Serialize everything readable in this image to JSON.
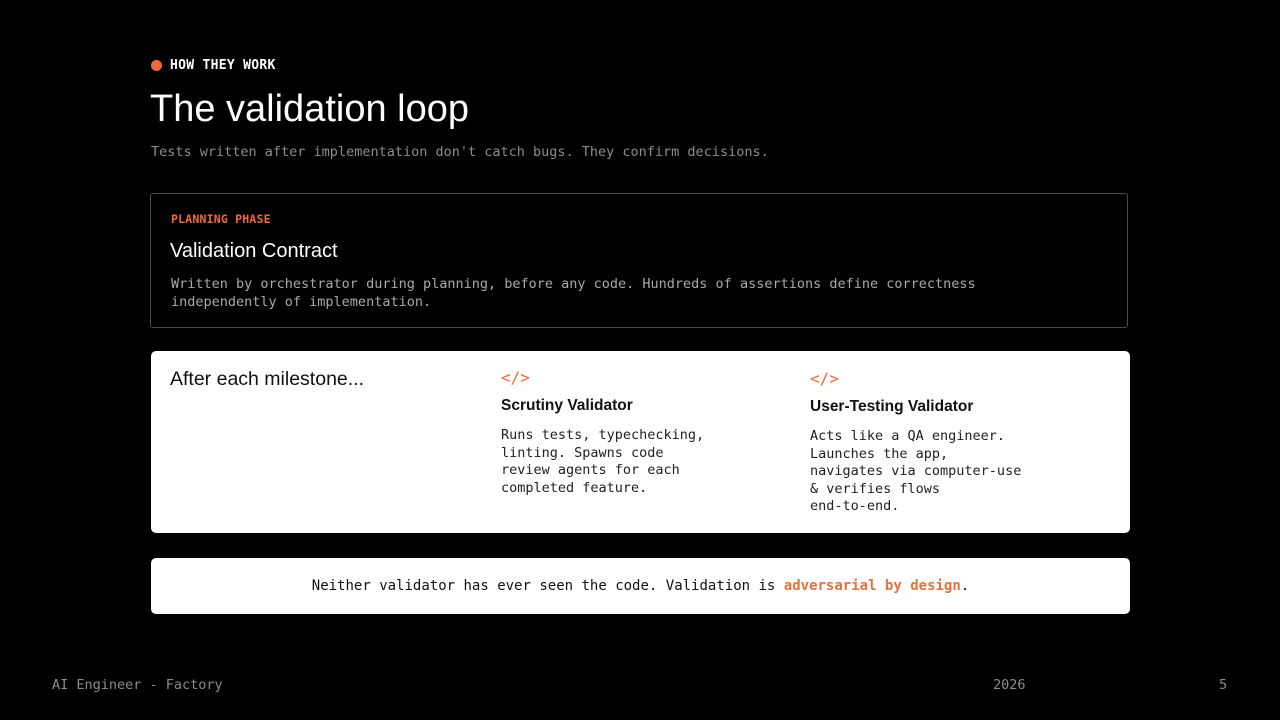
{
  "header": {
    "eyebrow": "HOW THEY WORK",
    "title": "The validation loop",
    "subtitle": "Tests written after implementation don't catch bugs. They confirm decisions."
  },
  "planning": {
    "phase": "PLANNING PHASE",
    "title": "Validation Contract",
    "description": "Written by orchestrator during planning, before any code. Hundreds of assertions define correctness independently of implementation."
  },
  "milestone": {
    "lead": "After each milestone...",
    "validators": [
      {
        "icon": "code-icon",
        "icon_glyph": "</>",
        "title": "Scrutiny Validator",
        "description": "Runs tests, typechecking,\nlinting. Spawns code\nreview agents for each\ncompleted feature."
      },
      {
        "icon": "code-icon",
        "icon_glyph": "</>",
        "title": "User-Testing Validator",
        "description": "Acts like a QA engineer.\nLaunches the app,\nnavigates via computer-use\n& verifies flows\nend-to-end."
      }
    ]
  },
  "note": {
    "prefix": "Neither validator has ever seen the code. Validation is ",
    "highlight": "adversarial by design",
    "suffix": "."
  },
  "footer": {
    "left": "AI Engineer - Factory",
    "year": "2026",
    "page": "5"
  },
  "colors": {
    "accent": "#ef6a3a",
    "background": "#000000",
    "card": "#ffffff"
  }
}
